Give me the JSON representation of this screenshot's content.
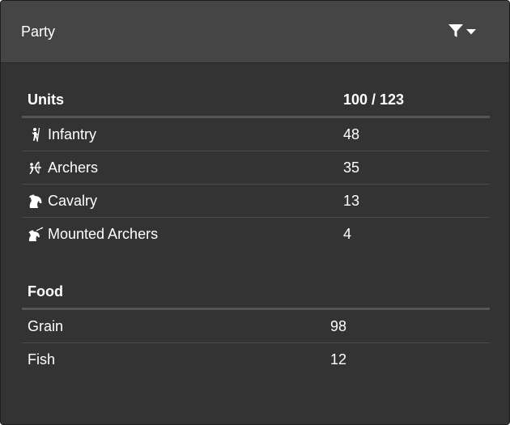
{
  "panel": {
    "title": "Party",
    "filter_icon": "filter-icon",
    "caret_icon": "caret-down-icon"
  },
  "units": {
    "header": {
      "name": "Units",
      "value": "100 / 123"
    },
    "rows": [
      {
        "name": "Infantry",
        "value": "48",
        "icon": "infantry-icon"
      },
      {
        "name": "Archers",
        "value": "35",
        "icon": "archer-icon"
      },
      {
        "name": "Cavalry",
        "value": "13",
        "icon": "cavalry-icon"
      },
      {
        "name": "Mounted Archers",
        "value": "4",
        "icon": "mounted-archer-icon"
      }
    ]
  },
  "food": {
    "header": {
      "name": "Food",
      "value": ""
    },
    "rows": [
      {
        "name": "Grain",
        "value": "98"
      },
      {
        "name": "Fish",
        "value": "12"
      }
    ]
  },
  "colors": {
    "panel_bg": "#333333",
    "header_bg": "#454545",
    "text": "#ffffff",
    "divider": "#555555"
  }
}
